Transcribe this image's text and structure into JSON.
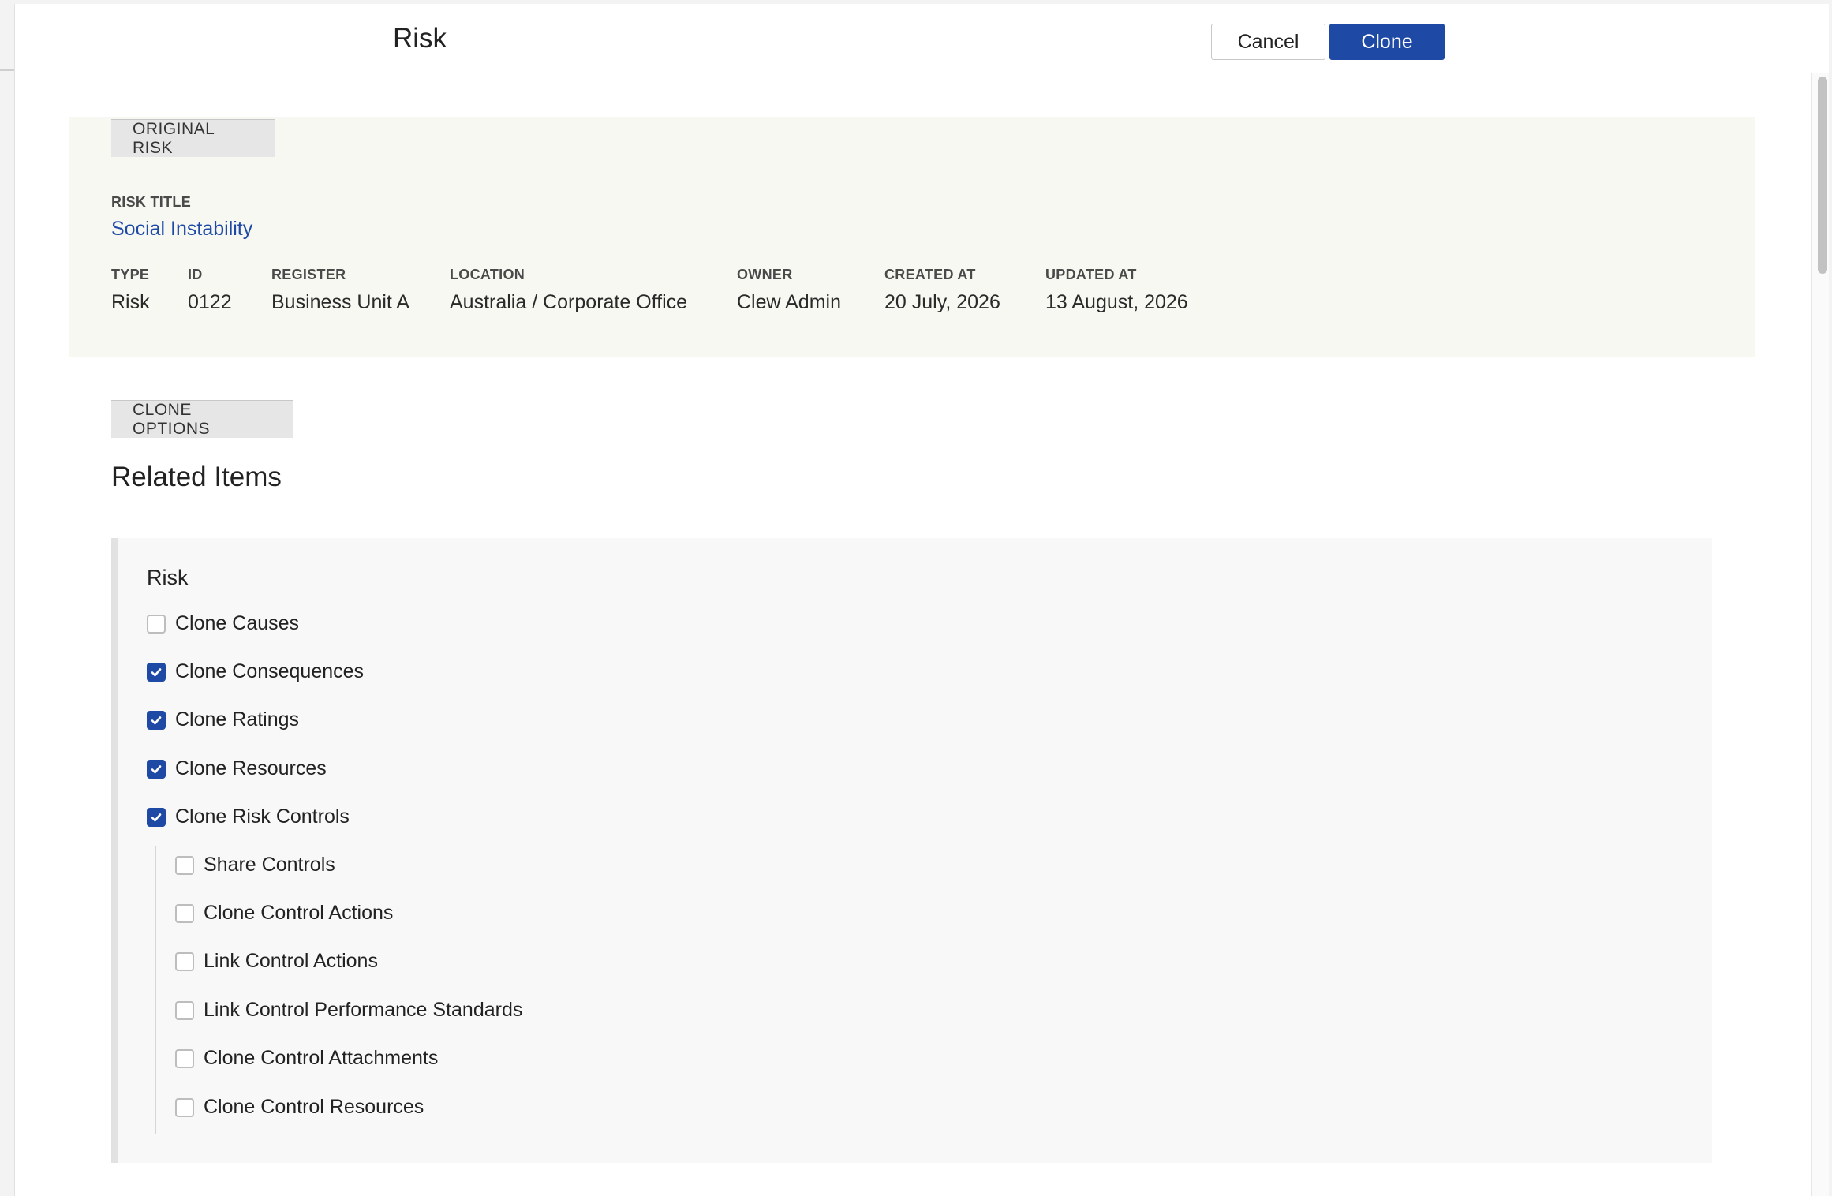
{
  "header": {
    "title": "Risk",
    "cancel_label": "Cancel",
    "clone_label": "Clone"
  },
  "original_risk": {
    "tag": "ORIGINAL RISK",
    "risk_title_label": "RISK TITLE",
    "risk_title_value": "Social Instability",
    "fields": [
      {
        "label": "TYPE",
        "value": "Risk"
      },
      {
        "label": "ID",
        "value": "0122"
      },
      {
        "label": "REGISTER",
        "value": "Business Unit A"
      },
      {
        "label": "LOCATION",
        "value": "Australia / Corporate Office"
      },
      {
        "label": "OWNER",
        "value": "Clew Admin"
      },
      {
        "label": "CREATED AT",
        "value": "20 July, 2026"
      },
      {
        "label": "UPDATED AT",
        "value": "13 August, 2026"
      }
    ]
  },
  "clone_options": {
    "tag": "CLONE OPTIONS",
    "related_items_heading": "Related Items",
    "risk_group_title": "Risk",
    "options": [
      {
        "label": "Clone Causes",
        "checked": false
      },
      {
        "label": "Clone Consequences",
        "checked": true
      },
      {
        "label": "Clone Ratings",
        "checked": true
      },
      {
        "label": "Clone Resources",
        "checked": true
      },
      {
        "label": "Clone Risk Controls",
        "checked": true
      }
    ],
    "control_sub_options": [
      {
        "label": "Share Controls",
        "checked": false
      },
      {
        "label": "Clone Control Actions",
        "checked": false
      },
      {
        "label": "Link Control Actions",
        "checked": false
      },
      {
        "label": "Link Control Performance Standards",
        "checked": false
      },
      {
        "label": "Clone Control Attachments",
        "checked": false
      },
      {
        "label": "Clone Control Resources",
        "checked": false
      }
    ]
  },
  "colors": {
    "accent": "#1e4aa5",
    "panel_bg": "#f8f8f3",
    "options_bg": "#f8f8f8"
  },
  "icons": {
    "checkbox_checked": "checkmark-icon"
  }
}
